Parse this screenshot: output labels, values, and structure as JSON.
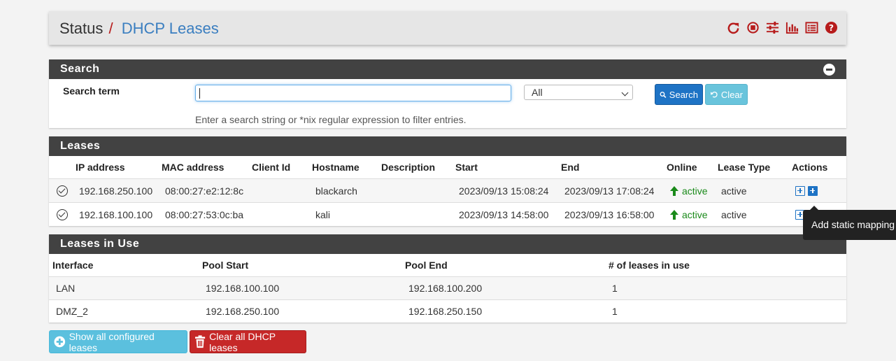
{
  "header": {
    "breadcrumb_root": "Status",
    "breadcrumb_sep": "/",
    "breadcrumb_page": "DHCP Leases",
    "icons": [
      "reload-icon",
      "stop-icon",
      "settings-icon",
      "chart-icon",
      "log-icon",
      "help-icon"
    ],
    "icon_color": "#b71c1c"
  },
  "search": {
    "title": "Search",
    "label": "Search term",
    "input_value": "",
    "filter_selected": "All",
    "search_button": "Search",
    "clear_button": "Clear",
    "help_text": "Enter a search string or *nix regular expression to filter entries."
  },
  "leases": {
    "title": "Leases",
    "columns": [
      "IP address",
      "MAC address",
      "Client Id",
      "Hostname",
      "Description",
      "Start",
      "End",
      "Online",
      "Lease Type",
      "Actions"
    ],
    "rows": [
      {
        "ip": "192.168.250.100",
        "mac": "08:00:27:e2:12:8c",
        "client_id": "",
        "hostname": "blackarch",
        "description": "",
        "start": "2023/09/13 15:08:24",
        "end": "2023/09/13 17:08:24",
        "online": "active",
        "lease_type": "active"
      },
      {
        "ip": "192.168.100.100",
        "mac": "08:00:27:53:0c:ba",
        "client_id": "",
        "hostname": "kali",
        "description": "",
        "start": "2023/09/13 14:58:00",
        "end": "2023/09/13 16:58:00",
        "online": "active",
        "lease_type": "active"
      }
    ]
  },
  "in_use": {
    "title": "Leases in Use",
    "columns": [
      "Interface",
      "Pool Start",
      "Pool End",
      "# of leases in use"
    ],
    "rows": [
      {
        "interface": "LAN",
        "pool_start": "192.168.100.100",
        "pool_end": "192.168.100.200",
        "count": "1"
      },
      {
        "interface": "DMZ_2",
        "pool_start": "192.168.250.100",
        "pool_end": "192.168.250.150",
        "count": "1"
      }
    ]
  },
  "tooltip": "Add static mapping",
  "bottom_buttons": {
    "show_all": "Show all configured leases",
    "clear_all": "Clear all DHCP leases"
  },
  "colors": {
    "accent": "#1e73c5",
    "danger": "#c62828",
    "info": "#5bc0de",
    "online": "#1a8a1a"
  }
}
